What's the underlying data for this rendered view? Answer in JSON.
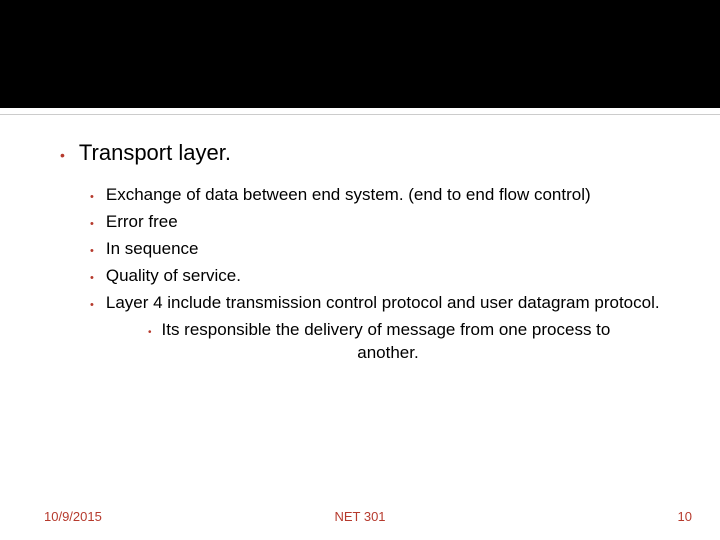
{
  "main_bullet": "Transport layer.",
  "sub_bullets": [
    "Exchange of data between end system. (end to end flow control)",
    "Error free",
    "In sequence",
    "Quality of service.",
    "Layer 4 include transmission control protocol and user datagram protocol."
  ],
  "subsub_line1": "Its responsible the delivery of message from one process to",
  "subsub_line2": "another.",
  "footer": {
    "date": "10/9/2015",
    "course": "NET 301",
    "page": "10"
  }
}
